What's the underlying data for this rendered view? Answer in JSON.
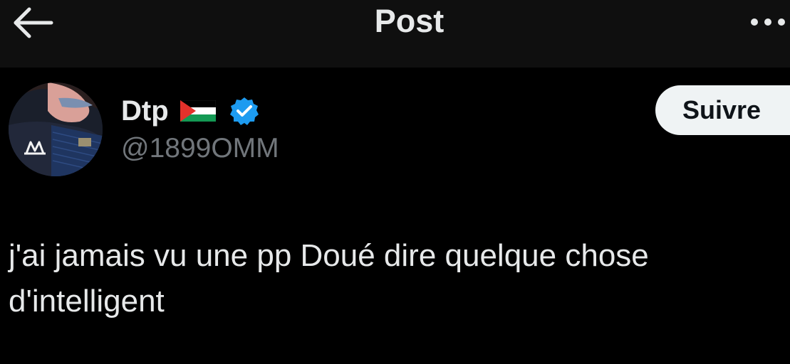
{
  "header": {
    "title": "Post",
    "back_icon": "arrow-left-icon",
    "more_icon": "ellipsis-horizontal-icon"
  },
  "author": {
    "display_name": "Dtp",
    "flag_icon": "palestine-flag-icon",
    "verified_icon": "verified-badge-icon",
    "handle": "@1899OMM"
  },
  "follow_button": {
    "label": "Suivre"
  },
  "post": {
    "text": "j'ai jamais vu une pp Doué dire quelque chose\nd'intelligent"
  },
  "colors": {
    "background": "#000000",
    "header_background": "#0f0f0f",
    "primary_text": "#e7e9ea",
    "secondary_text": "#71767b",
    "verified_blue": "#1d9bf0",
    "follow_button_bg": "#eff3f4"
  }
}
